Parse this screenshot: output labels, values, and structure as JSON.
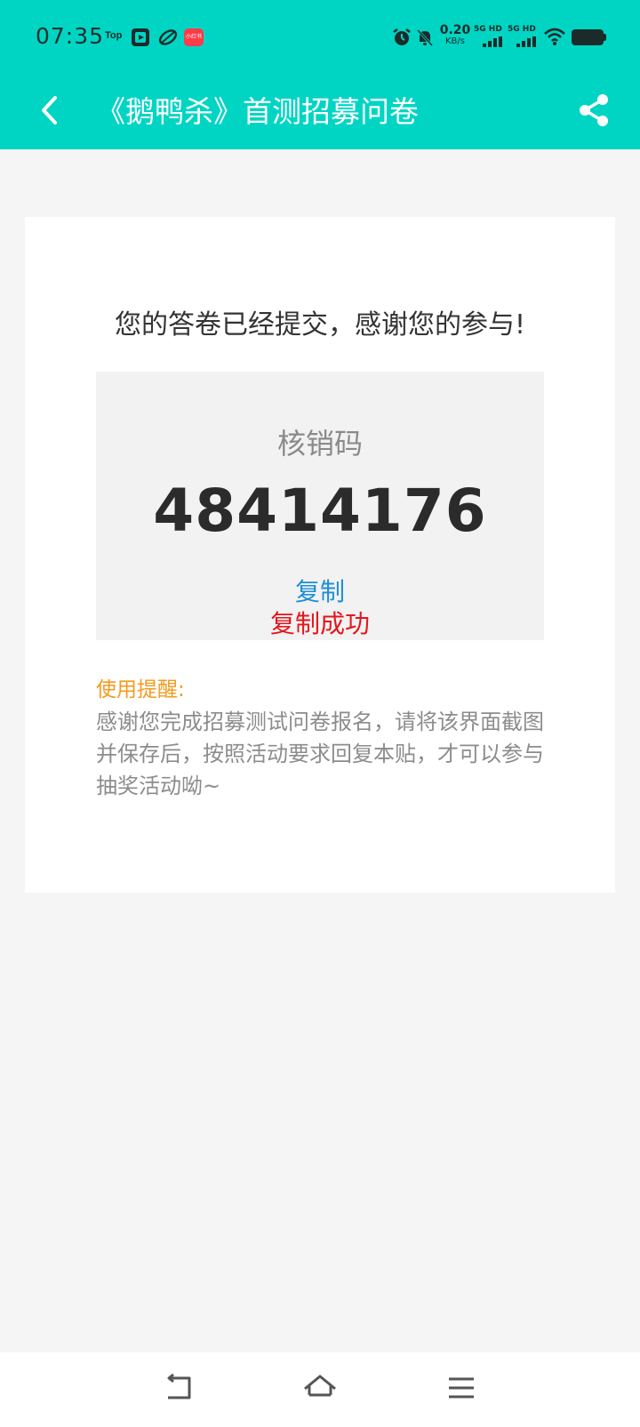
{
  "status_bar": {
    "time": "07:35",
    "top_app_label": "Top",
    "red_app_label": "小红书",
    "net_speed_value": "0.20",
    "net_speed_unit": "KB/s",
    "sim1_label": "5G HD",
    "sim2_label": "5G HD",
    "icons": [
      "top-app-icon",
      "video-app-icon",
      "leaf-app-icon",
      "red-app-icon",
      "alarm-icon",
      "mute-icon",
      "signal-icon",
      "wifi-icon",
      "battery-icon"
    ]
  },
  "app_bar": {
    "title": "《鹅鸭杀》首测招募问卷",
    "back_icon": "back-arrow-icon",
    "share_icon": "share-icon"
  },
  "card": {
    "message": "您的答卷已经提交，感谢您的参与!",
    "code_label": "核销码",
    "code_value": "48414176",
    "copy_label": "复制",
    "copy_success": "复制成功",
    "tip_title": "使用提醒:",
    "tip_text": "感谢您完成招募测试问卷报名，请将该界面截图并保存后，按照活动要求回复本贴，才可以参与抽奖活动呦~"
  },
  "nav_bar": {
    "icons": [
      "back-nav-icon",
      "home-icon",
      "menu-icon"
    ]
  },
  "colors": {
    "accent": "#00d5c4",
    "copy_link": "#1c8fd6",
    "success": "#e4161c",
    "tip_title": "#f39a1e"
  }
}
